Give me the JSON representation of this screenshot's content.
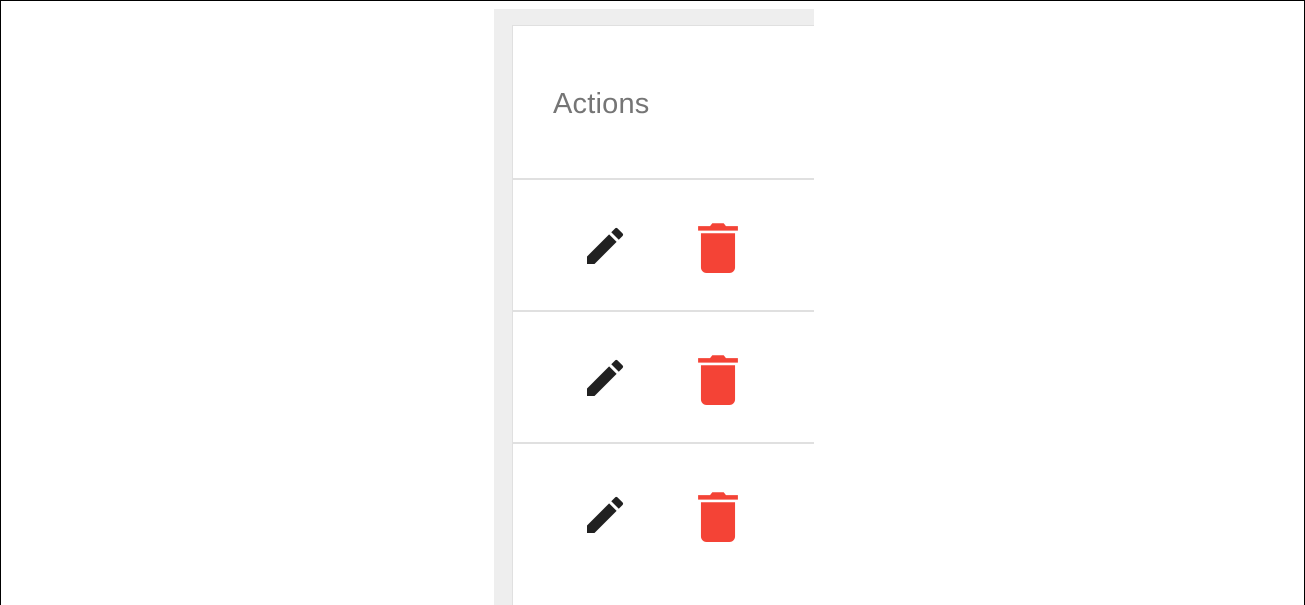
{
  "table": {
    "header": {
      "actions_label": "Actions"
    },
    "rows": [
      {
        "edit_icon": "pencil-icon",
        "delete_icon": "trash-icon"
      },
      {
        "edit_icon": "pencil-icon",
        "delete_icon": "trash-icon"
      },
      {
        "edit_icon": "pencil-icon",
        "delete_icon": "trash-icon"
      }
    ]
  },
  "colors": {
    "edit_icon": "#212121",
    "delete_icon": "#f44336",
    "header_text": "#757575",
    "divider": "#e0e0e0",
    "panel_background": "#eeeeee"
  }
}
